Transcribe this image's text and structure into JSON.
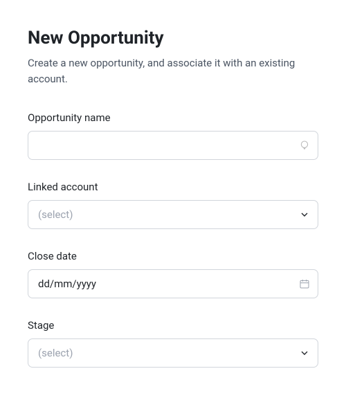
{
  "header": {
    "title": "New Opportunity",
    "subtitle": "Create a new opportunity, and associate it with an existing account."
  },
  "fields": {
    "opportunity_name": {
      "label": "Opportunity name",
      "value": ""
    },
    "linked_account": {
      "label": "Linked account",
      "placeholder": "(select)"
    },
    "close_date": {
      "label": "Close date",
      "placeholder": "dd/mm/yyyy"
    },
    "stage": {
      "label": "Stage",
      "placeholder": "(select)"
    }
  }
}
